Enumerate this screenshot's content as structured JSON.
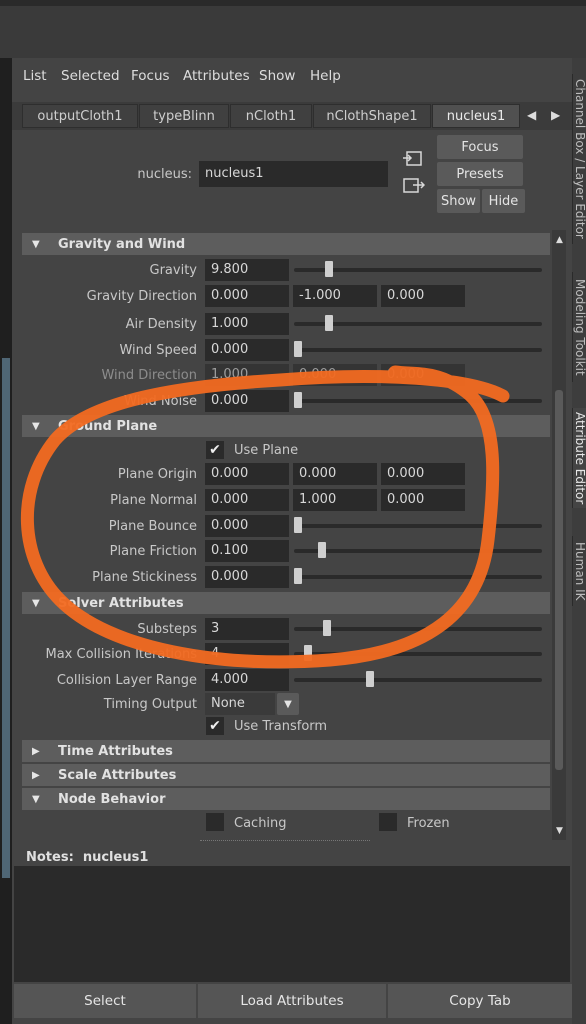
{
  "menu": [
    "List",
    "Selected",
    "Focus",
    "Attributes",
    "Show",
    "Help"
  ],
  "tabs": [
    {
      "label": "outputCloth1"
    },
    {
      "label": "typeBlinn"
    },
    {
      "label": "nCloth1"
    },
    {
      "label": "nClothShape1"
    },
    {
      "label": "nucleus1",
      "active": true
    }
  ],
  "tab_nav": {
    "left": "◀",
    "right": "▶"
  },
  "side_tabs": [
    "Channel Box / Layer Editor",
    "Modeling Toolkit",
    "Attribute Editor",
    "Human IK"
  ],
  "node": {
    "label": "nucleus:",
    "value": "nucleus1"
  },
  "buttons": {
    "focus": "Focus",
    "presets": "Presets",
    "show": "Show",
    "hide": "Hide"
  },
  "sections": {
    "gravity": {
      "title": "Gravity and Wind",
      "gravity": {
        "label": "Gravity",
        "value": "9.800",
        "slider": 0.13
      },
      "gravity_direction": {
        "label": "Gravity Direction",
        "x": "0.000",
        "y": "-1.000",
        "z": "0.000"
      },
      "air_density": {
        "label": "Air Density",
        "value": "1.000",
        "slider": 0.13
      },
      "wind_speed": {
        "label": "Wind Speed",
        "value": "0.000",
        "slider": 0.0
      },
      "wind_direction": {
        "label": "Wind Direction",
        "x": "1.000",
        "y": "0.000",
        "z": "0.000"
      },
      "wind_noise": {
        "label": "Wind Noise",
        "value": "0.000",
        "slider": 0.0
      }
    },
    "ground": {
      "title": "Ground Plane",
      "use_plane": {
        "label": "Use Plane",
        "checked": true
      },
      "plane_origin": {
        "label": "Plane Origin",
        "x": "0.000",
        "y": "0.000",
        "z": "0.000"
      },
      "plane_normal": {
        "label": "Plane Normal",
        "x": "0.000",
        "y": "1.000",
        "z": "0.000"
      },
      "plane_bounce": {
        "label": "Plane Bounce",
        "value": "0.000",
        "slider": 0.0
      },
      "plane_friction": {
        "label": "Plane Friction",
        "value": "0.100",
        "slider": 0.1
      },
      "plane_stickiness": {
        "label": "Plane Stickiness",
        "value": "0.000",
        "slider": 0.0
      }
    },
    "solver": {
      "title": "Solver Attributes",
      "substeps": {
        "label": "Substeps",
        "value": "3",
        "slider": 0.12
      },
      "max_collision": {
        "label": "Max Collision Iterations",
        "value": "4",
        "slider": 0.04
      },
      "collision_layer_range": {
        "label": "Collision Layer Range",
        "value": "4.000",
        "slider": 0.3
      },
      "timing_output": {
        "label": "Timing Output",
        "value": "None"
      },
      "use_transform": {
        "label": "Use Transform",
        "checked": true
      }
    },
    "time": {
      "title": "Time Attributes"
    },
    "scale": {
      "title": "Scale Attributes"
    },
    "node_behavior": {
      "title": "Node Behavior",
      "caching": {
        "label": "Caching",
        "checked": false
      },
      "frozen": {
        "label": "Frozen",
        "checked": false
      }
    }
  },
  "notes": {
    "label": "Notes:",
    "value": "nucleus1"
  },
  "bottom": {
    "select": "Select",
    "load": "Load Attributes",
    "copy": "Copy Tab"
  },
  "colors": {
    "annotation": "#f26a21",
    "panel": "#444444",
    "field": "#2a2a2a",
    "section": "#5d5d5d"
  }
}
